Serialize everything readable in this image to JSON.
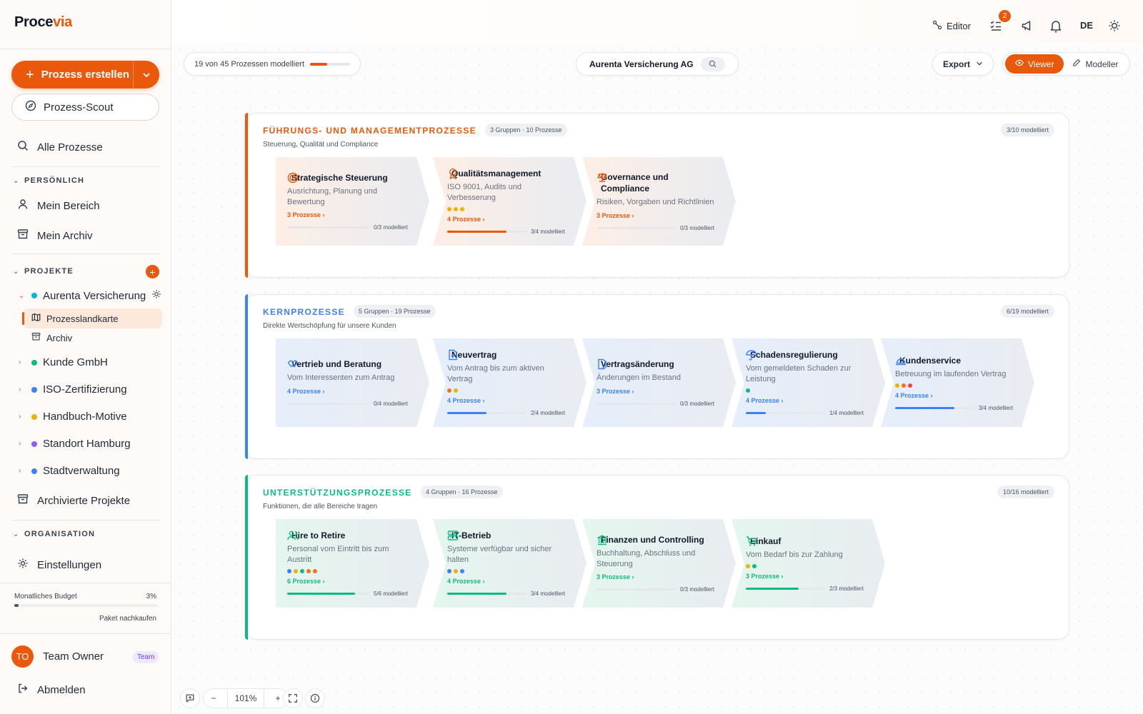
{
  "app": {
    "brand_part1": "Proce",
    "brand_part2": "via"
  },
  "sidebar": {
    "create_label": "Prozess erstellen",
    "scout_label": "Prozess-Scout",
    "all_processes": "Alle Prozesse",
    "personal_heading": "PERSÖNLICH",
    "my_area": "Mein Bereich",
    "my_archive": "Mein Archiv",
    "projects_heading": "PROJEKTE",
    "projects": [
      {
        "label": "Aurenta Versicherung",
        "color": "#06b6d4",
        "expanded": true
      },
      {
        "label": "Kunde GmbH",
        "color": "#10b981"
      },
      {
        "label": "ISO-Zertifizierung",
        "color": "#3b82f6"
      },
      {
        "label": "Handbuch-Motive",
        "color": "#eab308"
      },
      {
        "label": "Standort Hamburg",
        "color": "#8b5cf6"
      },
      {
        "label": "Stadtverwaltung",
        "color": "#3b82f6"
      }
    ],
    "sub_map": "Prozesslandkarte",
    "sub_archive": "Archiv",
    "archived_projects": "Archivierte Projekte",
    "org_heading": "ORGANISATION",
    "settings": "Einstellungen",
    "budget_label": "Monatliches Budget",
    "budget_pct": "3%",
    "budget_value": 0.03,
    "budget_link": "Paket nachkaufen",
    "user_initials": "TO",
    "user_name": "Team Owner",
    "user_badge": "Team",
    "logout": "Abmelden"
  },
  "topbar": {
    "editor": "Editor",
    "notif_count": "2",
    "lang": "DE"
  },
  "toolbar": {
    "progress_text": "19 von 45 Prozessen modelliert",
    "progress_value": 0.42,
    "company": "Aurenta Versicherung AG",
    "export": "Export",
    "viewer": "Viewer",
    "modeller": "Modeller",
    "zoom": "101%"
  },
  "lanes": [
    {
      "title": "FÜHRUNGS- UND MANAGEMENTPROZESSE",
      "badge": "3 Gruppen · 10 Prozesse",
      "subtitle": "Steuerung, Qualität und Compliance",
      "count": "3/10 modelliert",
      "color": "#ea580c",
      "cards": [
        {
          "icon": "target-icon",
          "title": "Strategische Steuerung",
          "desc": "Ausrichtung, Planung und Bewertung",
          "dots": [],
          "link": "3 Prozesse ›",
          "progress": 0,
          "pcount": "0/3 modelliert"
        },
        {
          "icon": "award-icon",
          "title": "Qualitätsmanagement",
          "desc": "ISO 9001, Audits und Verbesserung",
          "dots": [
            "#eab308",
            "#eab308",
            "#eab308"
          ],
          "link": "4 Prozesse ›",
          "progress": 0.75,
          "pcount": "3/4 modelliert"
        },
        {
          "icon": "scale-icon",
          "title": "Governance und Compliance",
          "desc": "Risiken, Vorgaben und Richtlinien",
          "dots": [],
          "link": "3 Prozesse ›",
          "progress": 0,
          "pcount": "0/3 modelliert"
        }
      ]
    },
    {
      "title": "KERNPROZESSE",
      "badge": "5 Gruppen · 19 Prozesse",
      "subtitle": "Direkte Wertschöpfung für unsere Kunden",
      "count": "6/19 modelliert",
      "color": "#3b82f6",
      "cards": [
        {
          "icon": "handshake-icon",
          "title": "Vertrieb und Beratung",
          "desc": "Vom Interessenten zum Antrag",
          "dots": [],
          "link": "4 Prozesse ›",
          "progress": 0,
          "pcount": "0/4 modelliert"
        },
        {
          "icon": "file-plus-icon",
          "title": "Neuvertrag",
          "desc": "Vom Antrag bis zum aktiven Vertrag",
          "dots": [
            "#f97316",
            "#eab308"
          ],
          "link": "4 Prozesse ›",
          "progress": 0.5,
          "pcount": "2/4 modelliert"
        },
        {
          "icon": "file-edit-icon",
          "title": "Vertragsänderung",
          "desc": "Änderungen im Bestand",
          "dots": [],
          "link": "3 Prozesse ›",
          "progress": 0,
          "pcount": "0/3 modelliert"
        },
        {
          "icon": "umbrella-icon",
          "title": "Schadensregulierung",
          "desc": "Vom gemeldeten Schaden zur Leistung",
          "dots": [
            "#10b981"
          ],
          "link": "4 Prozesse ›",
          "progress": 0.25,
          "pcount": "1/4 modelliert"
        },
        {
          "icon": "bell-service-icon",
          "title": "Kundenservice",
          "desc": "Betreuung im laufenden Vertrag",
          "dots": [
            "#eab308",
            "#f97316",
            "#ef4444"
          ],
          "link": "4 Prozesse ›",
          "progress": 0.75,
          "pcount": "3/4 modelliert"
        }
      ]
    },
    {
      "title": "UNTERSTÜTZUNGSPROZESSE",
      "badge": "4 Gruppen · 16 Prozesse",
      "subtitle": "Funktionen, die alle Bereiche tragen",
      "count": "10/16 modelliert",
      "color": "#10b981",
      "cards": [
        {
          "icon": "users-icon",
          "title": "Hire to Retire",
          "desc": "Personal vom Eintritt bis zum Austritt",
          "dots": [
            "#3b82f6",
            "#eab308",
            "#10b981",
            "#f97316",
            "#f97316"
          ],
          "link": "6 Prozesse ›",
          "progress": 0.83,
          "pcount": "5/6 modelliert"
        },
        {
          "icon": "server-icon",
          "title": "IT-Betrieb",
          "desc": "Systeme verfügbar und sicher halten",
          "dots": [
            "#3b82f6",
            "#eab308",
            "#3b82f6"
          ],
          "link": "4 Prozesse ›",
          "progress": 0.75,
          "pcount": "3/4 modelliert"
        },
        {
          "icon": "bank-icon",
          "title": "Finanzen und Controlling",
          "desc": "Buchhaltung, Abschluss und Steuerung",
          "dots": [],
          "link": "3 Prozesse ›",
          "progress": 0,
          "pcount": "0/3 modelliert"
        },
        {
          "icon": "cart-icon",
          "title": "Einkauf",
          "desc": "Vom Bedarf bis zur Zahlung",
          "dots": [
            "#eab308",
            "#10b981"
          ],
          "link": "3 Prozesse ›",
          "progress": 0.67,
          "pcount": "2/3 modelliert"
        }
      ]
    }
  ]
}
